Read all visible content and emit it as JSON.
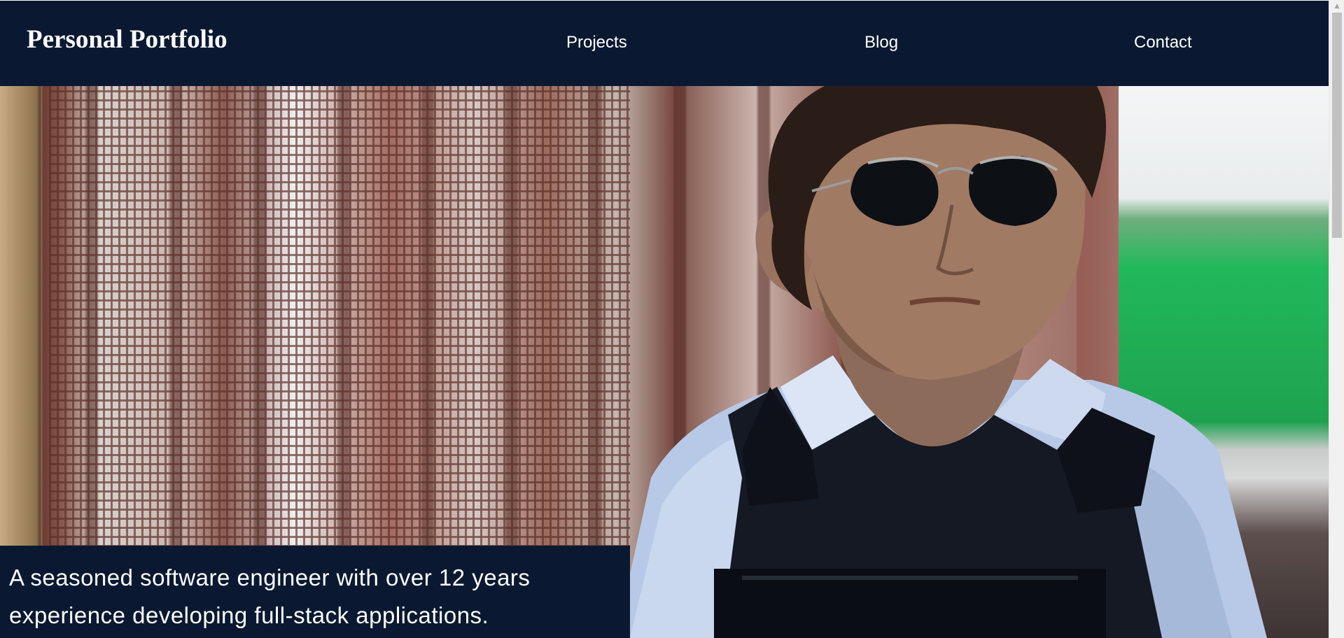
{
  "header": {
    "brand": "Personal Portfolio",
    "nav": [
      {
        "label": "Projects"
      },
      {
        "label": "Blog"
      },
      {
        "label": "Contact"
      }
    ]
  },
  "hero": {
    "image_subject": "man in sunglasses and tactical vest beside wire mesh fence",
    "caption": "A seasoned software engineer with over 12 years experience developing full-stack applications."
  },
  "colors": {
    "header_bg": "#0a1931",
    "caption_bg": "#0a1931",
    "text": "#ffffff"
  },
  "icons": {
    "scroll_up": "chevron-up-icon"
  }
}
